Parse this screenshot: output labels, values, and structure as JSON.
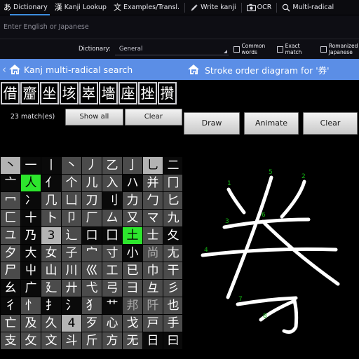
{
  "app": {
    "accent_blue": "#5b8ee6",
    "highlight_green": "#2de62d",
    "tab_underline": "#3c8dde"
  },
  "topbar": {
    "tabs": [
      {
        "glyph": "あ",
        "label": "Dictionary",
        "active": true,
        "icon": "hiragana-a-icon"
      },
      {
        "glyph": "漢",
        "label": "Kanji Lookup",
        "active": false,
        "icon": "kanji-icon"
      },
      {
        "glyph": "文",
        "label": "Examples/Transl.",
        "active": false,
        "icon": "text-icon"
      },
      {
        "glyph": "pen",
        "label": "Write kanji",
        "active": false,
        "icon": "pencil-icon"
      },
      {
        "glyph": "cam",
        "label": "OCR",
        "active": false,
        "icon": "camera-icon"
      },
      {
        "glyph": "mag",
        "label": "Multi-radical",
        "active": false,
        "icon": "magnifier-icon"
      }
    ]
  },
  "search": {
    "placeholder": "Enter English or Japanese",
    "value": ""
  },
  "options": {
    "dictionary_label": "Dictionary:",
    "dictionary_value": "General",
    "checkboxes": [
      {
        "label": "Common words",
        "checked": false
      },
      {
        "label": "Exact match",
        "checked": false
      },
      {
        "label": "Romanized Japanese",
        "checked": false
      }
    ]
  },
  "actionbar": {
    "left_title": "Kanj multi-radical search",
    "right_title": "Stroke order diagram for '券'",
    "back_chevron": "‹"
  },
  "results": {
    "chips": [
      "借",
      "齏",
      "坐",
      "垓",
      "崒",
      "墻",
      "座",
      "挫",
      "攢"
    ],
    "match_count_label": "23 match(es)",
    "show_all_label": "Show all",
    "clear_label": "Clear"
  },
  "draw_controls": {
    "draw_label": "Draw",
    "animate_label": "Animate",
    "clear_label": "Clear"
  },
  "radical_grid": {
    "rows": [
      [
        {
          "c": "丶",
          "s": "sel"
        },
        {
          "c": "一",
          "s": "dark"
        },
        {
          "c": "丨",
          "s": "dark"
        },
        {
          "c": "丶",
          "s": "normal"
        },
        {
          "c": "丿",
          "s": "normal"
        },
        {
          "c": "乙",
          "s": "normal"
        },
        {
          "c": "亅",
          "s": "normal"
        },
        {
          "c": "乚",
          "s": "sel"
        },
        {
          "c": "二",
          "s": "dark"
        }
      ],
      [
        {
          "c": "亠",
          "s": "dark"
        },
        {
          "c": "人",
          "s": "on"
        },
        {
          "c": "亻",
          "s": "dark"
        },
        {
          "c": "个",
          "s": "normal"
        },
        {
          "c": "儿",
          "s": "normal"
        },
        {
          "c": "入",
          "s": "normal"
        },
        {
          "c": "ハ",
          "s": "dark"
        },
        {
          "c": "并",
          "s": "normal"
        },
        {
          "c": "冂",
          "s": "normal"
        }
      ],
      [
        {
          "c": "冖",
          "s": "normal"
        },
        {
          "c": "冫",
          "s": "dark"
        },
        {
          "c": "几",
          "s": "normal"
        },
        {
          "c": "凵",
          "s": "normal"
        },
        {
          "c": "刀",
          "s": "normal"
        },
        {
          "c": "刂",
          "s": "dark"
        },
        {
          "c": "力",
          "s": "normal"
        },
        {
          "c": "勹",
          "s": "normal"
        },
        {
          "c": "匕",
          "s": "normal"
        }
      ],
      [
        {
          "c": "匚",
          "s": "normal"
        },
        {
          "c": "十",
          "s": "dark"
        },
        {
          "c": "卜",
          "s": "normal"
        },
        {
          "c": "卩",
          "s": "normal"
        },
        {
          "c": "厂",
          "s": "normal"
        },
        {
          "c": "厶",
          "s": "normal"
        },
        {
          "c": "又",
          "s": "normal"
        },
        {
          "c": "マ",
          "s": "normal"
        },
        {
          "c": "九",
          "s": "normal"
        }
      ],
      [
        {
          "c": "ユ",
          "s": "normal"
        },
        {
          "c": "乃",
          "s": "dark"
        },
        {
          "c": "3",
          "s": "sel"
        },
        {
          "c": "辶",
          "s": "normal"
        },
        {
          "c": "口",
          "s": "dark"
        },
        {
          "c": "囗",
          "s": "dark"
        },
        {
          "c": "土",
          "s": "on"
        },
        {
          "c": "士",
          "s": "normal"
        },
        {
          "c": "夂",
          "s": "dark"
        }
      ],
      [
        {
          "c": "夕",
          "s": "normal"
        },
        {
          "c": "大",
          "s": "dark"
        },
        {
          "c": "女",
          "s": "normal"
        },
        {
          "c": "子",
          "s": "normal"
        },
        {
          "c": "宀",
          "s": "normal"
        },
        {
          "c": "寸",
          "s": "normal"
        },
        {
          "c": "小",
          "s": "dark"
        },
        {
          "c": "尚",
          "s": "dim"
        },
        {
          "c": "尢",
          "s": "normal"
        }
      ],
      [
        {
          "c": "尸",
          "s": "normal"
        },
        {
          "c": "屮",
          "s": "dark"
        },
        {
          "c": "山",
          "s": "normal"
        },
        {
          "c": "川",
          "s": "normal"
        },
        {
          "c": "巛",
          "s": "normal"
        },
        {
          "c": "工",
          "s": "normal"
        },
        {
          "c": "已",
          "s": "normal"
        },
        {
          "c": "巾",
          "s": "normal"
        },
        {
          "c": "干",
          "s": "normal"
        }
      ],
      [
        {
          "c": "幺",
          "s": "dark"
        },
        {
          "c": "广",
          "s": "dark"
        },
        {
          "c": "廴",
          "s": "normal"
        },
        {
          "c": "廾",
          "s": "normal"
        },
        {
          "c": "弋",
          "s": "normal"
        },
        {
          "c": "弓",
          "s": "normal"
        },
        {
          "c": "彐",
          "s": "normal"
        },
        {
          "c": "彑",
          "s": "normal"
        },
        {
          "c": "彡",
          "s": "normal"
        }
      ],
      [
        {
          "c": "彳",
          "s": "dark"
        },
        {
          "c": "忄",
          "s": "normal"
        },
        {
          "c": "扌",
          "s": "dark"
        },
        {
          "c": "氵",
          "s": "dark"
        },
        {
          "c": "犭",
          "s": "normal"
        },
        {
          "c": "艹",
          "s": "dark"
        },
        {
          "c": "邦",
          "s": "dim"
        },
        {
          "c": "阡",
          "s": "dim"
        },
        {
          "c": "也",
          "s": "normal"
        }
      ],
      [
        {
          "c": "亡",
          "s": "normal"
        },
        {
          "c": "及",
          "s": "normal"
        },
        {
          "c": "久",
          "s": "normal"
        },
        {
          "c": "4",
          "s": "sel"
        },
        {
          "c": "歹",
          "s": "normal"
        },
        {
          "c": "心",
          "s": "normal"
        },
        {
          "c": "戈",
          "s": "normal"
        },
        {
          "c": "戸",
          "s": "normal"
        },
        {
          "c": "手",
          "s": "normal"
        }
      ],
      [
        {
          "c": "支",
          "s": "normal"
        },
        {
          "c": "攵",
          "s": "normal"
        },
        {
          "c": "文",
          "s": "normal"
        },
        {
          "c": "斗",
          "s": "normal"
        },
        {
          "c": "斤",
          "s": "normal"
        },
        {
          "c": "方",
          "s": "normal"
        },
        {
          "c": "无",
          "s": "normal"
        },
        {
          "c": "日",
          "s": "dark"
        },
        {
          "c": "曰",
          "s": "dark"
        }
      ]
    ]
  },
  "stroke_diagram": {
    "character": "券",
    "stroke_numbers": [
      "1",
      "2",
      "3",
      "4",
      "5",
      "6",
      "7",
      "8"
    ],
    "stroke_color": "#ffffff",
    "number_color": "#12b312",
    "background": "#000000"
  }
}
